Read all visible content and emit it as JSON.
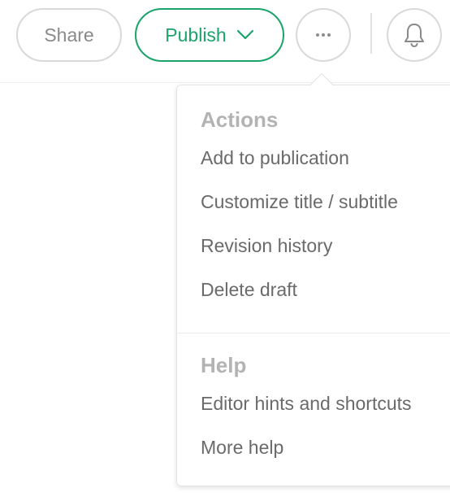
{
  "toolbar": {
    "share_label": "Share",
    "publish_label": "Publish",
    "more_icon": "ellipsis-icon",
    "bell_icon": "bell-icon",
    "accent_color": "#1aa36b"
  },
  "menu": {
    "actions": {
      "heading": "Actions",
      "items": [
        {
          "label": "Add to publication"
        },
        {
          "label": "Customize title / subtitle"
        },
        {
          "label": "Revision history"
        },
        {
          "label": "Delete draft"
        }
      ]
    },
    "help": {
      "heading": "Help",
      "items": [
        {
          "label": "Editor hints and shortcuts"
        },
        {
          "label": "More help"
        }
      ]
    }
  }
}
